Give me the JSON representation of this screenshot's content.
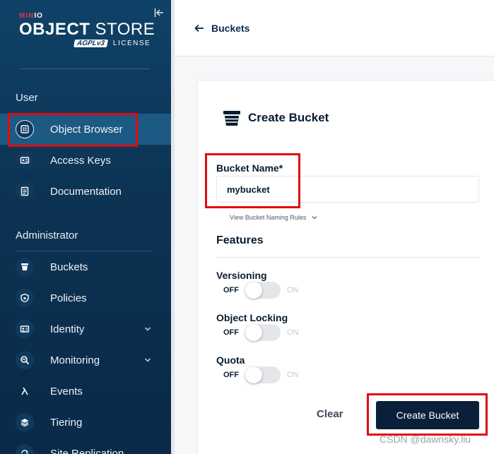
{
  "sidebar": {
    "brand_min": "MIN",
    "brand_io": "IO",
    "logo_bold": "OBJECT",
    "logo_rest": " STORE",
    "agpl": "AGPLv3",
    "license": "LICENSE",
    "sections": {
      "user": "User",
      "admin": "Administrator"
    },
    "user_items": [
      {
        "label": "Object Browser",
        "icon": "object-browser-icon",
        "active": true
      },
      {
        "label": "Access Keys",
        "icon": "access-keys-icon"
      },
      {
        "label": "Documentation",
        "icon": "documentation-icon"
      }
    ],
    "admin_items": [
      {
        "label": "Buckets",
        "icon": "bucket-icon"
      },
      {
        "label": "Policies",
        "icon": "policy-icon"
      },
      {
        "label": "Identity",
        "icon": "identity-icon",
        "expandable": true
      },
      {
        "label": "Monitoring",
        "icon": "monitoring-icon",
        "expandable": true
      },
      {
        "label": "Events",
        "icon": "lambda-icon"
      },
      {
        "label": "Tiering",
        "icon": "layers-icon"
      },
      {
        "label": "Site Replication",
        "icon": "replication-icon"
      }
    ]
  },
  "topbar": {
    "back_label": "Buckets"
  },
  "card": {
    "title": "Create Bucket",
    "bucket_name_label": "Bucket Name*",
    "bucket_name_value": "mybucket",
    "naming_rules": "View Bucket Naming Rules",
    "features_title": "Features",
    "features": [
      {
        "label": "Versioning",
        "state_off": "OFF",
        "state_on": "ON",
        "enabled": false
      },
      {
        "label": "Object Locking",
        "state_off": "OFF",
        "state_on": "ON",
        "enabled": false
      },
      {
        "label": "Quota",
        "state_off": "OFF",
        "state_on": "ON",
        "enabled": false
      }
    ],
    "clear_label": "Clear",
    "create_label": "Create Bucket"
  },
  "watermark": "CSDN @dawnsky.liu",
  "colors": {
    "sidebar": "#0c3253",
    "active_item": "#1d5a83",
    "primary_button": "#0a1f3a",
    "highlight": "#e10b10"
  }
}
